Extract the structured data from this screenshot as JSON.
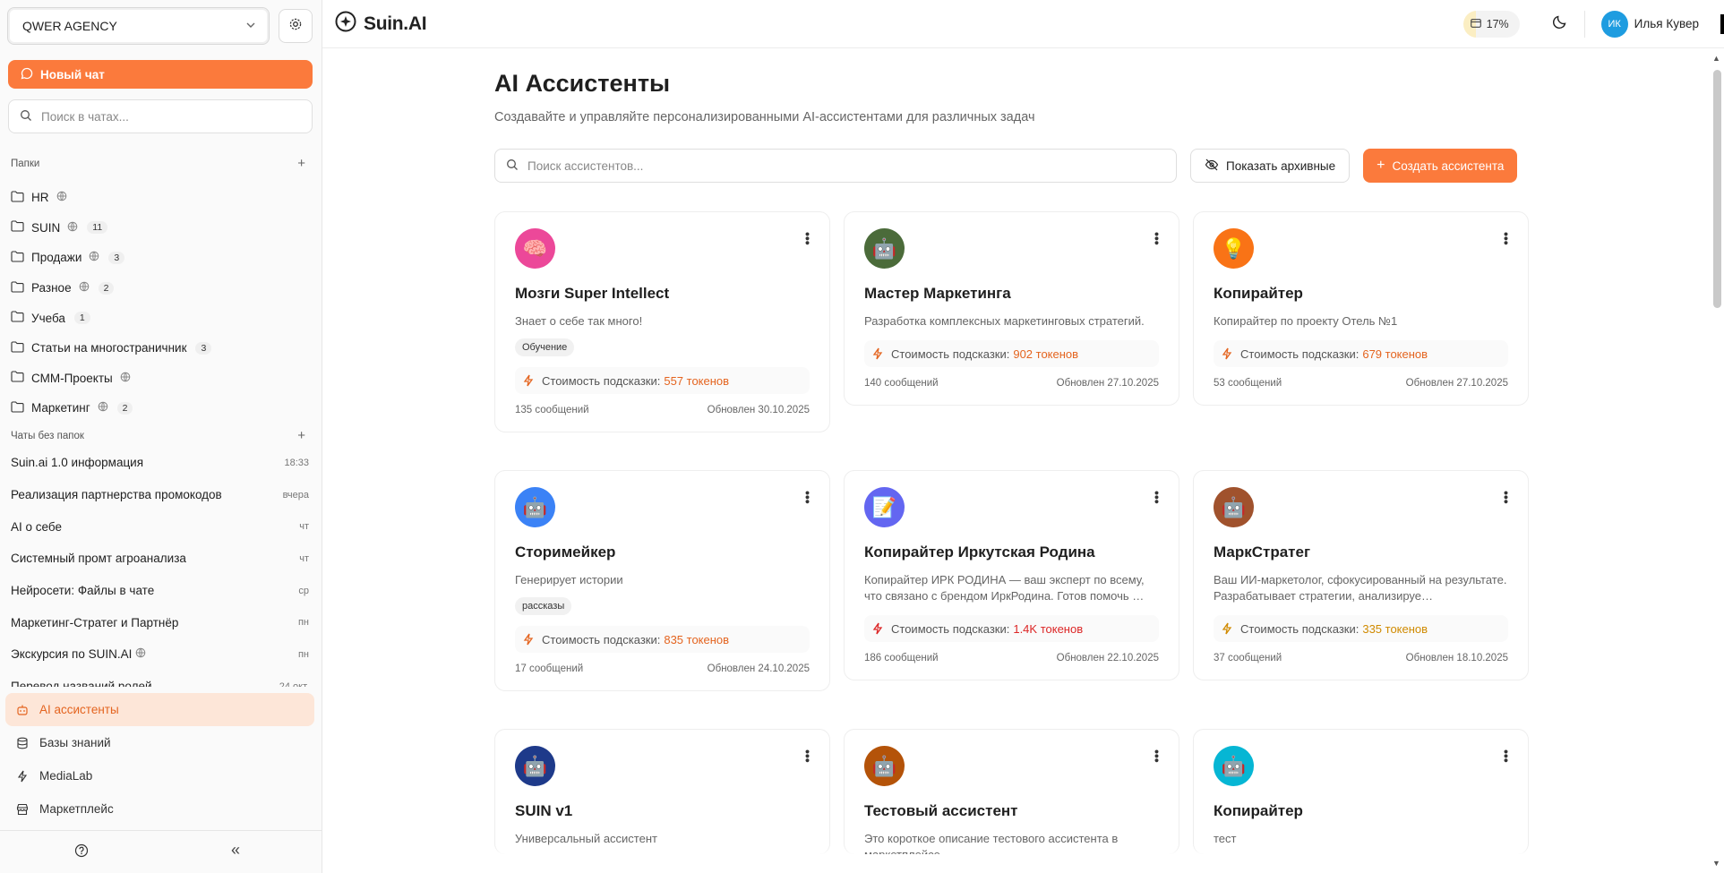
{
  "sidebar": {
    "workspace": "QWER AGENCY",
    "new_chat": "Новый чат",
    "search_placeholder": "Поиск в чатах...",
    "folders_title": "Папки",
    "folders": [
      {
        "name": "HR",
        "shared": true,
        "count": ""
      },
      {
        "name": "SUIN",
        "shared": true,
        "count": "11"
      },
      {
        "name": "Продажи",
        "shared": true,
        "count": "3"
      },
      {
        "name": "Разное",
        "shared": true,
        "count": "2"
      },
      {
        "name": "Учеба",
        "shared": false,
        "count": "1"
      },
      {
        "name": "Статьи на многостраничник",
        "shared": false,
        "count": "3"
      },
      {
        "name": "СММ-Проекты",
        "shared": true,
        "count": ""
      },
      {
        "name": "Маркетинг",
        "shared": true,
        "count": "2"
      }
    ],
    "chats_title": "Чаты без папок",
    "chats": [
      {
        "title": "Suin.ai 1.0 информация",
        "time": "18:33"
      },
      {
        "title": "Реализация партнерства промокодов",
        "time": "вчера"
      },
      {
        "title": "AI о себе",
        "time": "чт"
      },
      {
        "title": "Системный промт агроанализа",
        "time": "чт"
      },
      {
        "title": "Нейросети: Файлы в чате",
        "time": "ср"
      },
      {
        "title": "Маркетинг-Стратег и Партнёр",
        "time": "пн"
      },
      {
        "title": "Экскурсия по SUIN.AI",
        "time": "пн"
      },
      {
        "title": "Перевод названий ролей",
        "time": "24 окт."
      }
    ],
    "nav": [
      {
        "label": "AI ассистенты",
        "icon": "bot-icon",
        "active": true
      },
      {
        "label": "Базы знаний",
        "icon": "database-icon",
        "active": false
      },
      {
        "label": "MediaLab",
        "icon": "bolt-icon",
        "active": false
      },
      {
        "label": "Маркетплейс",
        "icon": "store-icon",
        "active": false
      }
    ],
    "collapse_label": "«"
  },
  "header": {
    "brand": "Suin.AI",
    "usage": "17%",
    "user_initials": "ИК",
    "user_name": "Илья Кувер"
  },
  "page": {
    "title": "AI Ассистенты",
    "subtitle": "Создавайте и управляйте персонализированными AI-ассистентами для различных задач",
    "search_placeholder": "Поиск ассистентов...",
    "archive_button": "Показать архивные",
    "create_button": "Создать ассистента",
    "cost_label": "Стоимость подсказки:"
  },
  "assistants": [
    {
      "name": "Мозги Super Intellect",
      "desc": "Знает о себе так много!",
      "tag": "Обучение",
      "cost": "557 токенов",
      "cost_color": "#e4641f",
      "messages": "135 сообщений",
      "updated": "Обновлен 30.10.2025",
      "avatar": "🧠",
      "avatar_bg": "#ec4899"
    },
    {
      "name": "Мастер Маркетинга",
      "desc": "Разработка комплексных маркетинговых стратегий.",
      "tag": "",
      "cost": "902 токенов",
      "cost_color": "#e4641f",
      "messages": "140 сообщений",
      "updated": "Обновлен 27.10.2025",
      "avatar": "🤖",
      "avatar_bg": "#4b6b3a"
    },
    {
      "name": "Копирайтер",
      "desc": "Копирайтер по проекту Отель №1",
      "tag": "",
      "cost": "679 токенов",
      "cost_color": "#e4641f",
      "messages": "53 сообщений",
      "updated": "Обновлен 27.10.2025",
      "avatar": "💡",
      "avatar_bg": "#f97316"
    },
    {
      "name": "Сторимейкер",
      "desc": "Генерирует истории",
      "tag": "рассказы",
      "cost": "835 токенов",
      "cost_color": "#e4641f",
      "messages": "17 сообщений",
      "updated": "Обновлен 24.10.2025",
      "avatar": "🤖",
      "avatar_bg": "#3b82f6"
    },
    {
      "name": "Копирайтер Иркутская Родина",
      "desc": "Копирайтер ИРК РОДИНА — ваш эксперт по всему, что связано с брендом ИркРодина. Готов помочь …",
      "tag": "",
      "cost": "1.4K токенов",
      "cost_color": "#dc2626",
      "messages": "186 сообщений",
      "updated": "Обновлен 22.10.2025",
      "avatar": "📝",
      "avatar_bg": "#6366f1"
    },
    {
      "name": "МаркСтратег",
      "desc": "Ваш ИИ-маркетолог, сфокусированный на результате. Разрабатывает стратегии, анализируе…",
      "tag": "",
      "cost": "335 токенов",
      "cost_color": "#d08a00",
      "messages": "37 сообщений",
      "updated": "Обновлен 18.10.2025",
      "avatar": "🤖",
      "avatar_bg": "#a0522d"
    },
    {
      "name": "SUIN v1",
      "desc": "Универсальный ассистент",
      "tag": "",
      "cost": "",
      "cost_color": "#e4641f",
      "messages": "",
      "updated": "",
      "avatar": "🤖",
      "avatar_bg": "#1e3a8a"
    },
    {
      "name": "Тестовый ассистент",
      "desc": "Это короткое описание тестового ассистента в маркетплейсе",
      "tag": "",
      "cost": "",
      "cost_color": "#e4641f",
      "messages": "",
      "updated": "",
      "avatar": "🤖",
      "avatar_bg": "#b45309"
    },
    {
      "name": "Копирайтер",
      "desc": "тест",
      "tag": "",
      "cost": "",
      "cost_color": "#e4641f",
      "messages": "",
      "updated": "",
      "avatar": "🤖",
      "avatar_bg": "#06b6d4"
    }
  ],
  "colors": {
    "accent": "#fb7a3c",
    "active_bg": "#fde6d8",
    "avatar_user": "#1e9ce0"
  }
}
